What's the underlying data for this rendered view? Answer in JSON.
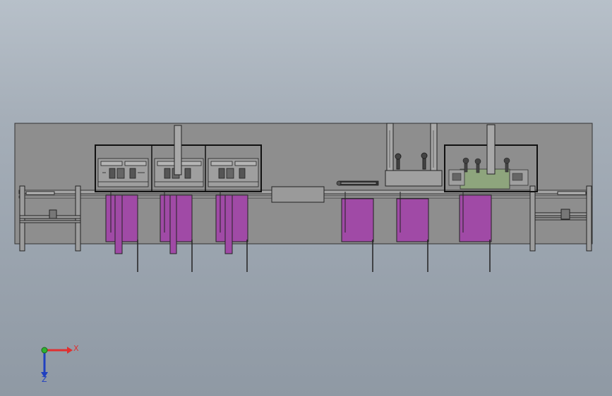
{
  "viewport": {
    "background_top": "#b7c0c9",
    "background_bottom": "#8f99a4"
  },
  "colors": {
    "frame": "#8e8e8e",
    "line": "#222222",
    "purple": "#a04aa6",
    "green_panel": "#8ea57d",
    "box": "#9a9a9a",
    "triad_x": "#e03030",
    "triad_y": "#30b030",
    "triad_z": "#2040c0"
  },
  "triad": {
    "x_label": "X",
    "z_label": "Z"
  }
}
